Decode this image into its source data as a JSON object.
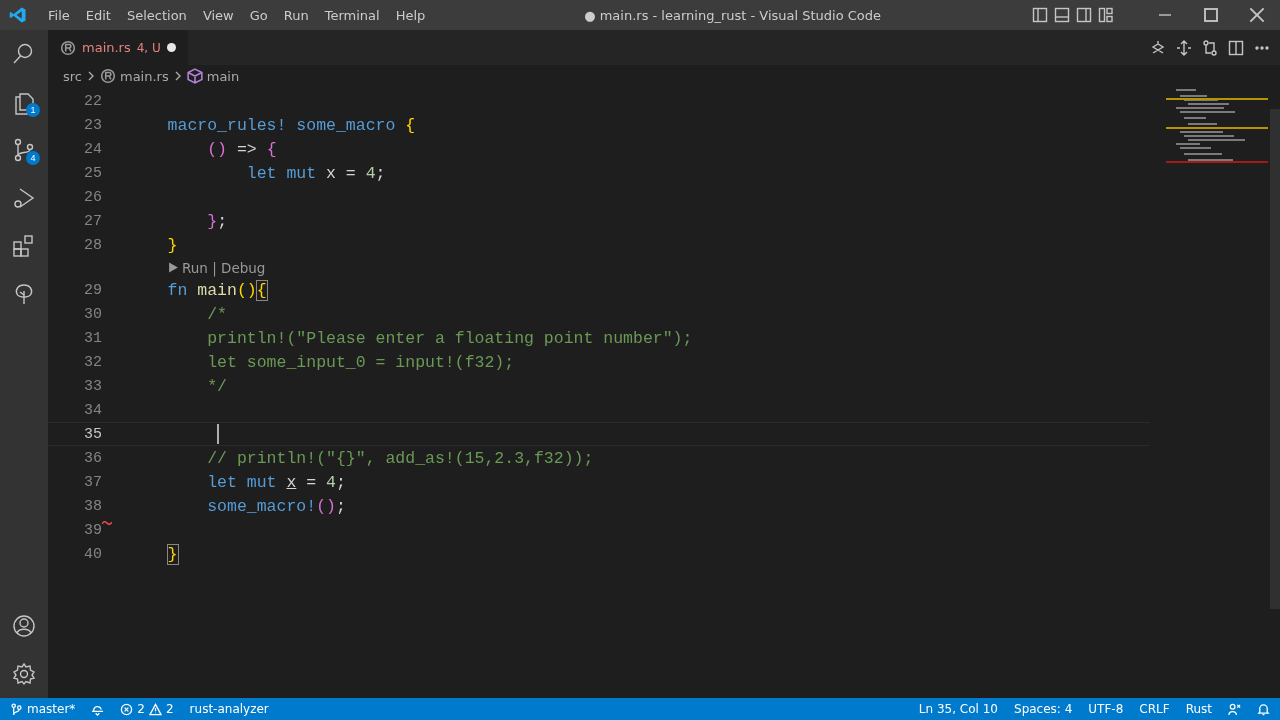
{
  "window": {
    "title": "● main.rs - learning_rust - Visual Studio Code",
    "menu": [
      "File",
      "Edit",
      "Selection",
      "View",
      "Go",
      "Run",
      "Terminal",
      "Help"
    ]
  },
  "activity_bar": {
    "items": [
      {
        "kind": "search",
        "selected": false
      },
      {
        "kind": "explorer",
        "selected": false,
        "badge": "1"
      },
      {
        "kind": "source-control",
        "selected": false,
        "badge": "4"
      },
      {
        "kind": "run-debug",
        "selected": false
      },
      {
        "kind": "extensions",
        "selected": false
      },
      {
        "kind": "remote",
        "selected": false
      }
    ],
    "bottom": [
      {
        "kind": "account"
      },
      {
        "kind": "settings"
      }
    ]
  },
  "tabs": [
    {
      "label": "main.rs",
      "decoration": "4, U",
      "selected": true,
      "dirty": true
    }
  ],
  "breadcrumbs": [
    {
      "kind": "folder",
      "label": "src"
    },
    {
      "kind": "file",
      "label": "main.rs"
    },
    {
      "kind": "symbol",
      "label": "main"
    }
  ],
  "editor": {
    "lines": [
      {
        "kind": "code",
        "number": "22"
      },
      {
        "kind": "code",
        "number": "23",
        "tokens": [
          {
            "text": "    macro_rules! ",
            "kind": "keyword"
          },
          {
            "text": "some_macro ",
            "kind": "macro"
          },
          {
            "text": "{",
            "kind": "bracket1"
          }
        ]
      },
      {
        "kind": "code",
        "number": "24",
        "tokens": [
          {
            "text": "        ()",
            "kind": "bracket2"
          },
          {
            "text": " => ",
            "kind": "plain"
          },
          {
            "text": "{",
            "kind": "bracket2"
          }
        ]
      },
      {
        "kind": "code",
        "number": "25",
        "tokens": [
          {
            "text": "            let mut ",
            "kind": "keyword"
          },
          {
            "text": "x = ",
            "kind": "plain"
          },
          {
            "text": "4",
            "kind": "number"
          },
          {
            "text": ";",
            "kind": "plain"
          }
        ]
      },
      {
        "kind": "code",
        "number": "26"
      },
      {
        "kind": "code",
        "number": "27",
        "tokens": [
          {
            "text": "        }",
            "kind": "bracket2"
          },
          {
            "text": ";",
            "kind": "plain"
          }
        ]
      },
      {
        "kind": "code",
        "number": "28",
        "tokens": [
          {
            "text": "    }",
            "kind": "bracket1"
          }
        ]
      },
      {
        "kind": "codelens",
        "text": "Run | Debug"
      },
      {
        "kind": "code",
        "number": "29",
        "tokens": [
          {
            "text": "    fn ",
            "kind": "keyword"
          },
          {
            "text": "main",
            "kind": "function"
          },
          {
            "text": "()",
            "kind": "bracket1"
          },
          {
            "text": "{",
            "kind": "bracket1",
            "matched": true
          }
        ]
      },
      {
        "kind": "code",
        "number": "30",
        "tokens": [
          {
            "text": "        /*",
            "kind": "comment"
          }
        ]
      },
      {
        "kind": "code",
        "number": "31",
        "tokens": [
          {
            "text": "        println!(\"Please enter a floating point number\");",
            "kind": "comment"
          }
        ]
      },
      {
        "kind": "code",
        "number": "32",
        "tokens": [
          {
            "text": "        let some_input_0 = input!(f32);",
            "kind": "comment"
          }
        ]
      },
      {
        "kind": "code",
        "number": "33",
        "tokens": [
          {
            "text": "        */",
            "kind": "comment"
          }
        ]
      },
      {
        "kind": "code",
        "number": "34"
      },
      {
        "kind": "code",
        "number": "35",
        "current": true
      },
      {
        "kind": "code",
        "number": "36",
        "tokens": [
          {
            "text": "        // println!(\"{}\", add_as!(15,2.3,f32));",
            "kind": "comment"
          }
        ]
      },
      {
        "kind": "code",
        "number": "37",
        "tokens": [
          {
            "text": "        let mut ",
            "kind": "keyword"
          },
          {
            "text": "x",
            "kind": "unused"
          },
          {
            "text": " = ",
            "kind": "plain"
          },
          {
            "text": "4",
            "kind": "number"
          },
          {
            "text": ";",
            "kind": "plain"
          }
        ]
      },
      {
        "kind": "code",
        "number": "38",
        "tokens": [
          {
            "text": "        some_macro!",
            "kind": "macro"
          },
          {
            "text": "()",
            "kind": "bracket2"
          },
          {
            "text": ";",
            "kind": "plain"
          }
        ]
      },
      {
        "kind": "code",
        "number": "39",
        "error_marker": true
      },
      {
        "kind": "code",
        "number": "40",
        "tokens": [
          {
            "text": "    }",
            "kind": "bracket1",
            "matched": true
          }
        ]
      }
    ]
  },
  "status_bar": {
    "branch": "master*",
    "errors": "2",
    "warnings": "2",
    "language_server": "rust-analyzer",
    "position": "Ln 35, Col 10",
    "indentation": "Spaces: 4",
    "encoding": "UTF-8",
    "line_ending": "CRLF",
    "language": "Rust"
  }
}
